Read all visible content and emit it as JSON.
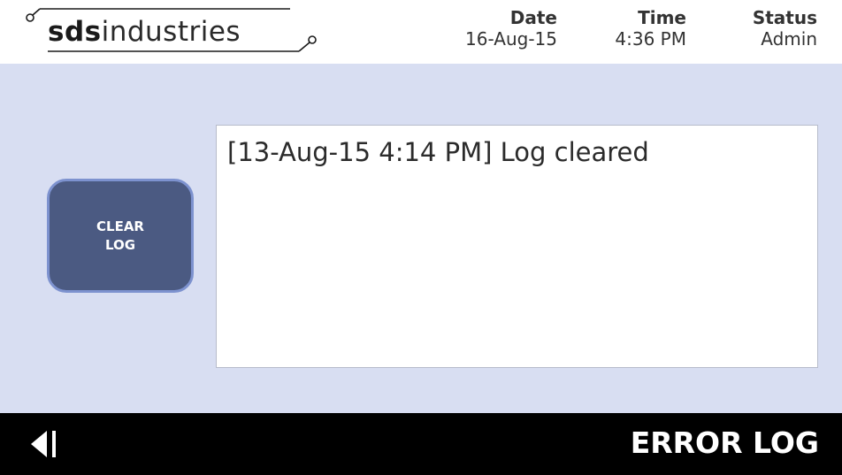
{
  "header": {
    "logo": {
      "brand_bold": "sds",
      "brand_light": "industries",
      "icon": "circuit-trace-logo"
    },
    "date": {
      "label": "Date",
      "value": "16-Aug-15"
    },
    "time": {
      "label": "Time",
      "value": "4:36 PM"
    },
    "status": {
      "label": "Status",
      "value": "Admin"
    }
  },
  "main": {
    "clear_button": {
      "line1": "CLEAR",
      "line2": "LOG"
    },
    "log_entries": [
      "[13-Aug-15 4:14 PM] Log cleared"
    ]
  },
  "footer": {
    "back_icon": "back-arrow-icon",
    "title": "ERROR LOG"
  },
  "colors": {
    "header_bg": "#ffffff",
    "main_bg": "#d8def2",
    "button_fill": "#4b5a82",
    "button_border": "#7d92cf",
    "footer_bg": "#000000",
    "text_dark": "#333333"
  }
}
